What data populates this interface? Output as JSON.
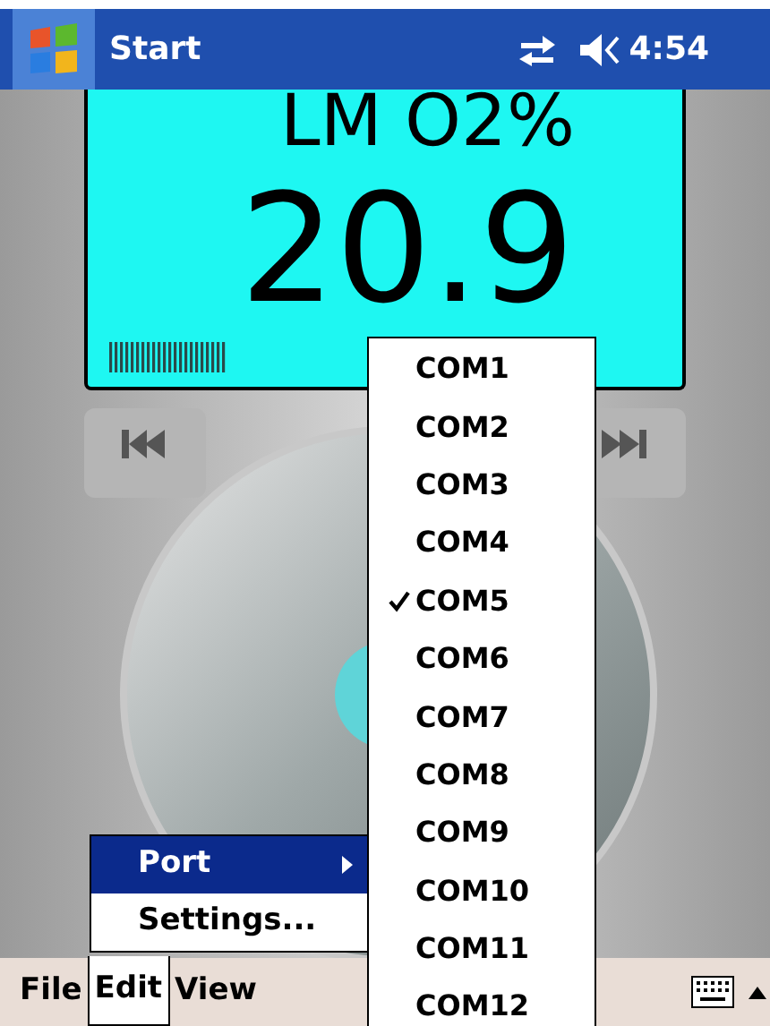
{
  "status_bar": {
    "start_label": "Start",
    "time": "4:54"
  },
  "display": {
    "label": "LM O2%",
    "value": "20.9"
  },
  "menu_bar": [
    {
      "label": "File",
      "selected": false
    },
    {
      "label": "Edit",
      "selected": true
    },
    {
      "label": "View",
      "selected": false
    }
  ],
  "edit_menu": [
    {
      "label": "Port",
      "selected": true,
      "submenu": true
    },
    {
      "label": "Settings...",
      "selected": false,
      "submenu": false
    }
  ],
  "port_menu": [
    {
      "label": "COM1",
      "checked": false
    },
    {
      "label": "COM2",
      "checked": false
    },
    {
      "label": "COM3",
      "checked": false
    },
    {
      "label": "COM4",
      "checked": false
    },
    {
      "label": "COM5",
      "checked": true
    },
    {
      "label": "COM6",
      "checked": false
    },
    {
      "label": "COM7",
      "checked": false
    },
    {
      "label": "COM8",
      "checked": false
    },
    {
      "label": "COM9",
      "checked": false
    },
    {
      "label": "COM10",
      "checked": false
    },
    {
      "label": "COM11",
      "checked": false
    },
    {
      "label": "COM12",
      "checked": false
    }
  ]
}
